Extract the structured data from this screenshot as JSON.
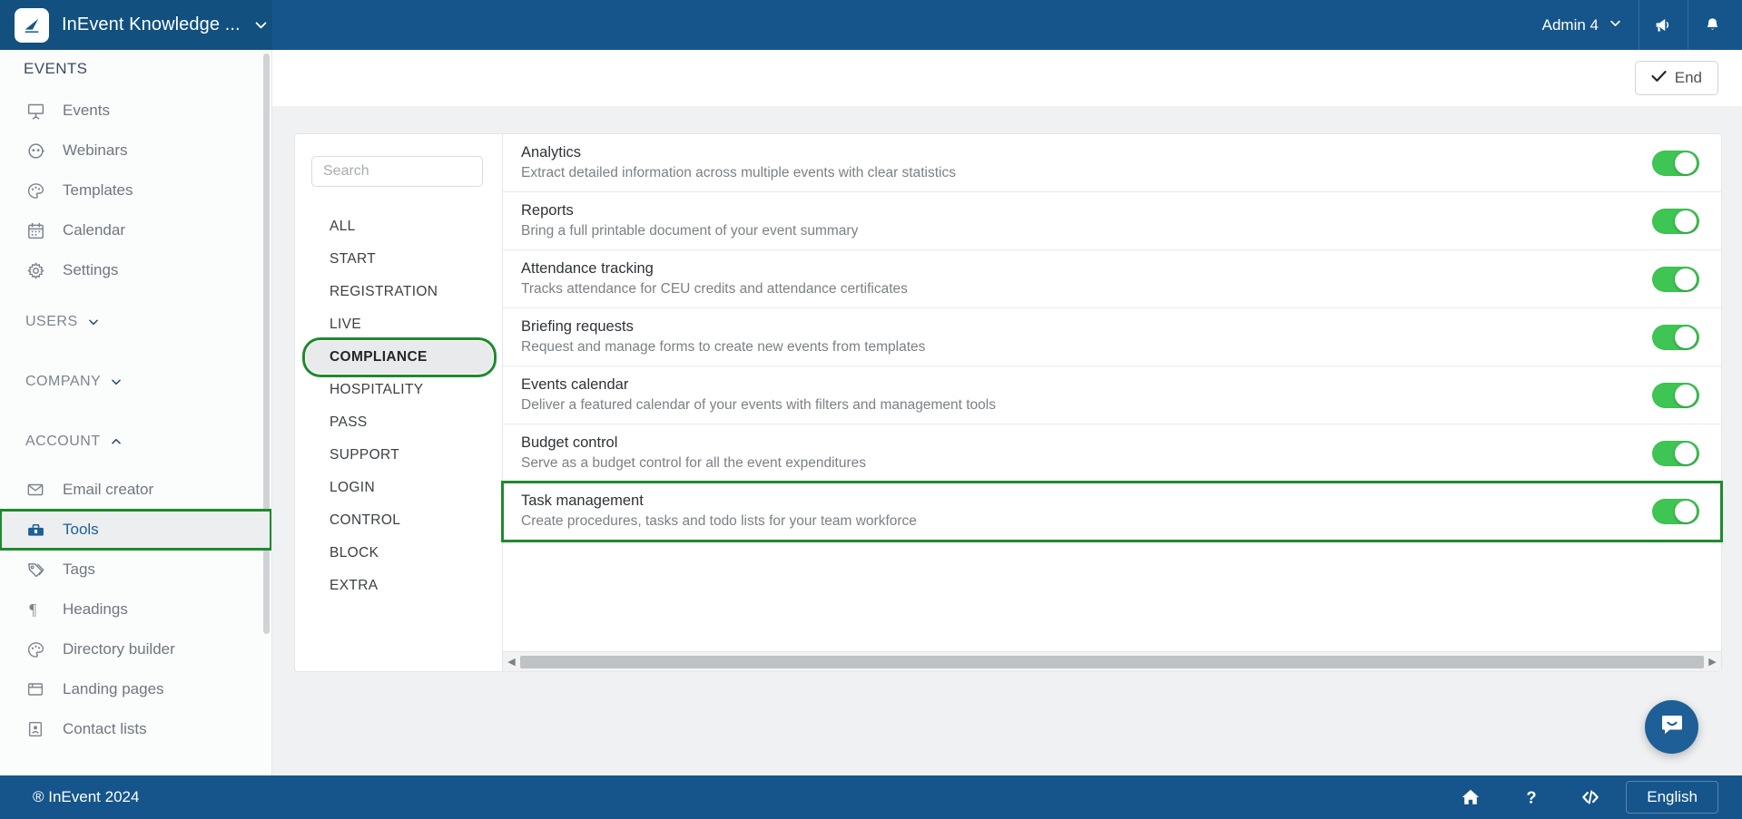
{
  "header": {
    "brand_title": "InEvent Knowledge ...",
    "brand_caret_icon": "chevron-down-icon",
    "logo_icon": "inevent-logo-icon",
    "user_name": "Admin 4",
    "user_caret_icon": "chevron-down-icon",
    "announcement_icon": "megaphone-icon",
    "notification_icon": "bell-icon",
    "background_color": "#16558c"
  },
  "toolbar": {
    "end_label": "End",
    "end_icon": "check-icon"
  },
  "sidebar": {
    "section_title": "EVENTS",
    "items": [
      {
        "label": "Events",
        "icon": "presentation-screen-icon"
      },
      {
        "label": "Webinars",
        "icon": "webinar-icon"
      },
      {
        "label": "Templates",
        "icon": "palette-icon"
      },
      {
        "label": "Calendar",
        "icon": "calendar-icon"
      },
      {
        "label": "Settings",
        "icon": "gear-icon"
      }
    ],
    "groups": [
      {
        "label": "USERS",
        "caret_icon": "chevron-down-icon",
        "expanded": false
      },
      {
        "label": "COMPANY",
        "caret_icon": "chevron-down-icon",
        "expanded": false
      },
      {
        "label": "ACCOUNT",
        "caret_icon": "chevron-up-icon",
        "expanded": true
      }
    ],
    "account_items": [
      {
        "label": "Email creator",
        "icon": "envelope-icon",
        "active": false,
        "highlighted": false
      },
      {
        "label": "Tools",
        "icon": "toolbox-icon",
        "active": true,
        "highlighted": true
      },
      {
        "label": "Tags",
        "icon": "tag-icon",
        "active": false,
        "highlighted": false
      },
      {
        "label": "Headings",
        "icon": "paragraph-icon",
        "active": false,
        "highlighted": false
      },
      {
        "label": "Directory builder",
        "icon": "palette-icon",
        "active": false,
        "highlighted": false
      },
      {
        "label": "Landing pages",
        "icon": "browser-window-icon",
        "active": false,
        "highlighted": false
      },
      {
        "label": "Contact lists",
        "icon": "contact-card-icon",
        "active": false,
        "highlighted": false
      }
    ],
    "highlight_color": "#1f8a2e"
  },
  "search": {
    "value": "",
    "placeholder": "Search"
  },
  "categories": [
    {
      "label": "ALL",
      "active": false,
      "highlighted": false
    },
    {
      "label": "START",
      "active": false,
      "highlighted": false
    },
    {
      "label": "REGISTRATION",
      "active": false,
      "highlighted": false
    },
    {
      "label": "LIVE",
      "active": false,
      "highlighted": false
    },
    {
      "label": "COMPLIANCE",
      "active": true,
      "highlighted": true
    },
    {
      "label": "HOSPITALITY",
      "active": false,
      "highlighted": false
    },
    {
      "label": "PASS",
      "active": false,
      "highlighted": false
    },
    {
      "label": "SUPPORT",
      "active": false,
      "highlighted": false
    },
    {
      "label": "LOGIN",
      "active": false,
      "highlighted": false
    },
    {
      "label": "CONTROL",
      "active": false,
      "highlighted": false
    },
    {
      "label": "BLOCK",
      "active": false,
      "highlighted": false
    },
    {
      "label": "EXTRA",
      "active": false,
      "highlighted": false
    }
  ],
  "tools": [
    {
      "title": "Analytics",
      "description": "Extract detailed information across multiple events with clear statistics",
      "enabled": true,
      "highlighted": false
    },
    {
      "title": "Reports",
      "description": "Bring a full printable document of your event summary",
      "enabled": true,
      "highlighted": false
    },
    {
      "title": "Attendance tracking",
      "description": "Tracks attendance for CEU credits and attendance certificates",
      "enabled": true,
      "highlighted": false
    },
    {
      "title": "Briefing requests",
      "description": "Request and manage forms to create new events from templates",
      "enabled": true,
      "highlighted": false
    },
    {
      "title": "Events calendar",
      "description": "Deliver a featured calendar of your events with filters and management tools",
      "enabled": true,
      "highlighted": false
    },
    {
      "title": "Budget control",
      "description": "Serve as a budget control for all the event expenditures",
      "enabled": true,
      "highlighted": false
    },
    {
      "title": "Task management",
      "description": "Create procedures, tasks and todo lists for your team workforce",
      "enabled": true,
      "highlighted": true
    }
  ],
  "chat": {
    "icon": "chat-bubble-icon"
  },
  "footer": {
    "copyright": "® InEvent 2024",
    "icons": [
      {
        "name": "home-icon"
      },
      {
        "name": "question-mark-icon"
      },
      {
        "name": "code-icon"
      }
    ],
    "language_label": "English"
  },
  "colors": {
    "brand_blue": "#16558c",
    "toggle_on": "#3fc553",
    "highlight_green": "#1f8a2e",
    "active_blue": "#1d5f96"
  }
}
